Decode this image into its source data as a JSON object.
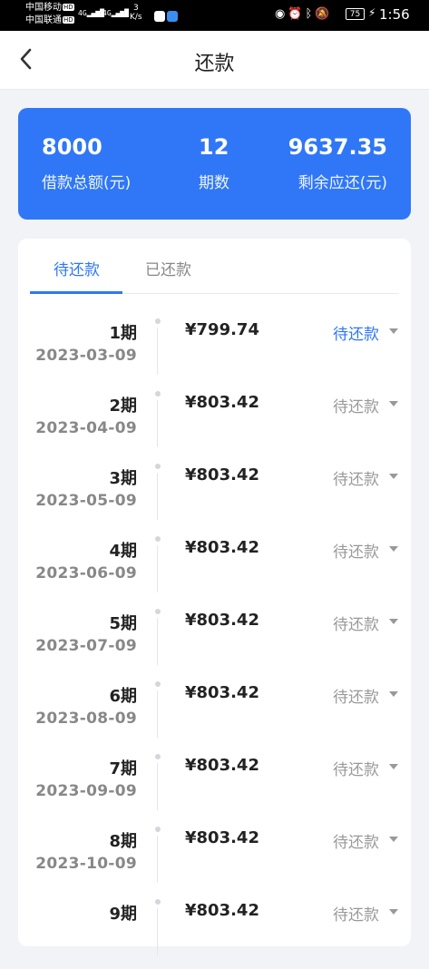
{
  "statusbar": {
    "carrier1": "中国移动",
    "carrier2": "中国联通",
    "hd": "HD",
    "net": "4G",
    "speed_value": "3",
    "speed_unit": "K/s",
    "battery": "75",
    "time": "1:56"
  },
  "header": {
    "title": "还款"
  },
  "summary": {
    "total": {
      "value": "8000",
      "label": "借款总额(元)"
    },
    "periods": {
      "value": "12",
      "label": "期数"
    },
    "remaining": {
      "value": "9637.35",
      "label": "剩余应还(元)"
    }
  },
  "tabs": [
    {
      "label": "待还款",
      "active": true
    },
    {
      "label": "已还款",
      "active": false
    }
  ],
  "installments": [
    {
      "period": "1期",
      "date": "2023-03-09",
      "amount": "¥799.74",
      "status": "待还款",
      "current": true
    },
    {
      "period": "2期",
      "date": "2023-04-09",
      "amount": "¥803.42",
      "status": "待还款",
      "current": false
    },
    {
      "period": "3期",
      "date": "2023-05-09",
      "amount": "¥803.42",
      "status": "待还款",
      "current": false
    },
    {
      "period": "4期",
      "date": "2023-06-09",
      "amount": "¥803.42",
      "status": "待还款",
      "current": false
    },
    {
      "period": "5期",
      "date": "2023-07-09",
      "amount": "¥803.42",
      "status": "待还款",
      "current": false
    },
    {
      "period": "6期",
      "date": "2023-08-09",
      "amount": "¥803.42",
      "status": "待还款",
      "current": false
    },
    {
      "period": "7期",
      "date": "2023-09-09",
      "amount": "¥803.42",
      "status": "待还款",
      "current": false
    },
    {
      "period": "8期",
      "date": "2023-10-09",
      "amount": "¥803.42",
      "status": "待还款",
      "current": false
    },
    {
      "period": "9期",
      "date": "",
      "amount": "¥803.42",
      "status": "待还款",
      "current": false
    }
  ],
  "colors": {
    "accent": "#2f77f6",
    "muted": "#999999"
  }
}
